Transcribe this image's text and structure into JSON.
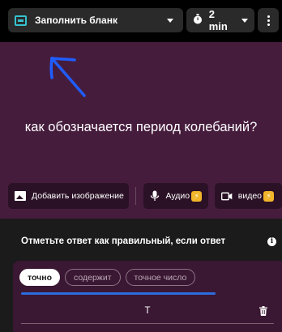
{
  "toolbar": {
    "question_type": "Заполнить бланк",
    "time_limit": "2 min"
  },
  "question": {
    "text": "как обозначается период колебаний?"
  },
  "media": {
    "add_image_label": "Добавить изображение",
    "audio_label": "Аудио",
    "video_label": "видео"
  },
  "answers": {
    "title": "Отметьте ответ как правильный, если ответ",
    "match_options": [
      "точно",
      "содержит",
      "точное число"
    ],
    "selected_match": "точно",
    "answer_value": "T"
  },
  "colors": {
    "accent": "#35c3cf",
    "question_bg": "#461c3d",
    "answer_bg": "#3a1733",
    "progress": "#2b6de0",
    "premium_badge": "#f0b52a"
  },
  "icons": {
    "question_type": "fill-blank-icon",
    "timer": "stopwatch-icon",
    "menu": "more-vertical-icon",
    "image": "image-icon",
    "audio": "microphone-icon",
    "video": "video-camera-icon",
    "premium": "lightning-icon",
    "info": "info-icon",
    "delete": "trash-icon"
  }
}
